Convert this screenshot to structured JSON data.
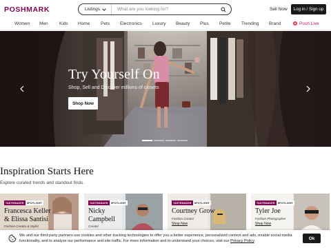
{
  "header": {
    "logo": "POSHMARK",
    "search": {
      "category": "Listings",
      "placeholder": "What are you looking for?"
    },
    "sell_now": "Sell Now",
    "login": "Log in / Sign up"
  },
  "nav": {
    "items": [
      "Women",
      "Men",
      "Kids",
      "Home",
      "Pets",
      "Electronics",
      "Luxury",
      "Beauty",
      "Plus",
      "Petite",
      "Trending",
      "Brand"
    ],
    "live": "Posh Live"
  },
  "hero": {
    "title": "Try Yourself On",
    "subtitle": "Shop, Sell and Discover millions of closets",
    "button": "Shop Now",
    "slides_total": 4,
    "slide_active": 1
  },
  "inspiration": {
    "title": "Inspiration Starts Here",
    "subtitle": "Explore curated trends and standout finds.",
    "badge_main": "TASTEMAKER",
    "badge_secondary": "SPOTLIGHT",
    "cards": [
      {
        "name_line1": "Francesca Keller",
        "name_line2": "& Elissa Santisi",
        "role": "Fashion Creator & Stylist",
        "link": ""
      },
      {
        "name_line1": "Nicky",
        "name_line2": "Campbell",
        "role": "Creator",
        "link": ""
      },
      {
        "name_line1": "Courtney Grow",
        "name_line2": "",
        "role": "Fashion Creator",
        "link": "Shop Now"
      },
      {
        "name_line1": "Tyler Joe",
        "name_line2": "",
        "role": "Fashion Photographer",
        "link": "Shop Now"
      }
    ]
  },
  "cookie": {
    "text": "We and our third-party partners use cookies and other tracking technologies to offer you a better experience, personalized content and ads, enable social media functionality, and to analyze our performance and site traffic. For more information and to understand your choices, visit our",
    "link": "Privacy Policy",
    "ok": "Ok"
  },
  "colors": {
    "brand": "#7f0353",
    "dark": "#1a1a1a",
    "live": "#e23b5b"
  }
}
